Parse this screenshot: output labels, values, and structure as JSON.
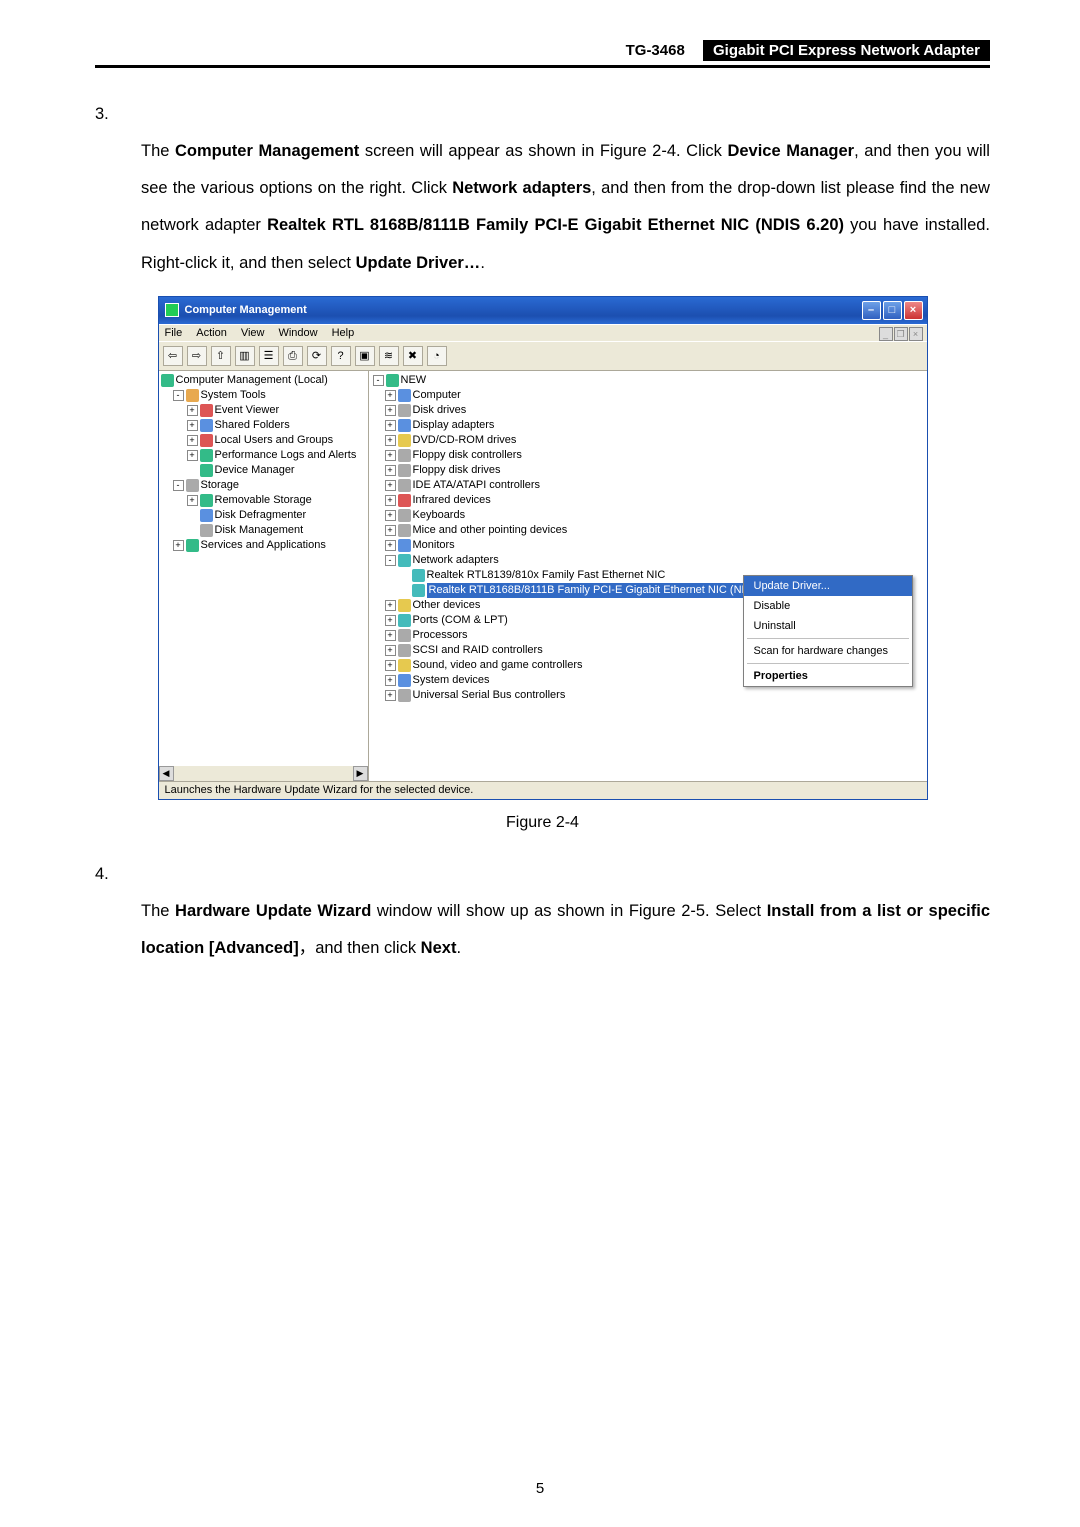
{
  "header": {
    "model": "TG-3468",
    "title": "Gigabit PCI Express Network Adapter"
  },
  "step3": {
    "num": "3.",
    "text_1": "The ",
    "b1": "Computer Management",
    "text_2": " screen will appear as shown in Figure 2-4. Click ",
    "b2": "Device Manager",
    "text_3": ", and then you will see the various options on the right. Click ",
    "b3": "Network adapters",
    "text_4": ", and then from the drop-down list please find the new network adapter ",
    "b4": "Realtek RTL 8168B/8111B Family PCI-E Gigabit Ethernet NIC (NDIS 6.20)",
    "text_5": " you have installed. Right-click it, and then select ",
    "b5": "Update Driver…",
    "text_6": "."
  },
  "window": {
    "title": "Computer Management",
    "menu": [
      "File",
      "Action",
      "View",
      "Window",
      "Help"
    ],
    "status": "Launches the Hardware Update Wizard for the selected device."
  },
  "left_tree": {
    "root": "Computer Management (Local)",
    "n1": "System Tools",
    "n1a": "Event Viewer",
    "n1b": "Shared Folders",
    "n1c": "Local Users and Groups",
    "n1d": "Performance Logs and Alerts",
    "n1e": "Device Manager",
    "n2": "Storage",
    "n2a": "Removable Storage",
    "n2b": "Disk Defragmenter",
    "n2c": "Disk Management",
    "n3": "Services and Applications"
  },
  "right_tree": {
    "root": "NEW",
    "items": [
      "Computer",
      "Disk drives",
      "Display adapters",
      "DVD/CD-ROM drives",
      "Floppy disk controllers",
      "Floppy disk drives",
      "IDE ATA/ATAPI controllers",
      "Infrared devices",
      "Keyboards",
      "Mice and other pointing devices",
      "Monitors"
    ],
    "net": "Network adapters",
    "net_child1": "Realtek RTL8139/810x Family Fast Ethernet NIC",
    "net_child2": "Realtek RTL8168B/8111B Family PCI-E Gigabit Ethernet NIC (NDIS 6.20)",
    "after": [
      "Other devices",
      "Ports (COM & LPT)",
      "Processors",
      "SCSI and RAID controllers",
      "Sound, video and game controllers",
      "System devices",
      "Universal Serial Bus controllers"
    ]
  },
  "ctx": {
    "update": "Update Driver...",
    "disable": "Disable",
    "uninstall": "Uninstall",
    "scan": "Scan for hardware changes",
    "props": "Properties"
  },
  "fig_caption": "Figure 2-4",
  "step4": {
    "num": "4.",
    "text_1": "The ",
    "b1": "Hardware Update Wizard",
    "text_2": " window will show up as shown in Figure 2-5. Select ",
    "b2": "Install from a list or specific location [Advanced]",
    "text_3": "，and then click ",
    "b3": "Next",
    "text_4": "."
  },
  "page_number": "5"
}
